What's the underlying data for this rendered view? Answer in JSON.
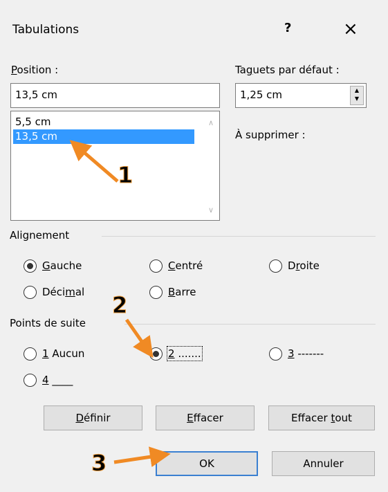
{
  "title": "Tabulations",
  "help_label": "?",
  "close_label": "×",
  "position": {
    "label_pre": "",
    "label_ul": "P",
    "label_post": "osition :",
    "value": "13,5 cm",
    "items": [
      "5,5 cm",
      "13,5 cm"
    ],
    "selected_index": 1
  },
  "default_tabs": {
    "label_pre": "Ta",
    "label_ul": "g",
    "label_post": "uets par défaut :",
    "value": "1,25 cm"
  },
  "to_delete_label": "À supprimer :",
  "alignment": {
    "heading": "Alignement",
    "options": [
      {
        "pre": "",
        "ul": "G",
        "post": "auche",
        "checked": true
      },
      {
        "pre": "",
        "ul": "C",
        "post": "entré",
        "checked": false
      },
      {
        "pre": "D",
        "ul": "r",
        "post": "oite",
        "checked": false
      },
      {
        "pre": "Déci",
        "ul": "m",
        "post": "al",
        "checked": false
      },
      {
        "pre": "",
        "ul": "B",
        "post": "arre",
        "checked": false
      }
    ]
  },
  "leader": {
    "heading": "Points de suite",
    "options": [
      {
        "pre": "",
        "ul": "1",
        "post": " Aucun",
        "checked": false
      },
      {
        "pre": "",
        "ul": "2",
        "post": " .......",
        "checked": true
      },
      {
        "pre": "",
        "ul": "3",
        "post": " -------",
        "checked": false
      },
      {
        "pre": "",
        "ul": "4",
        "post": " ____",
        "checked": false
      }
    ]
  },
  "buttons": {
    "define": {
      "pre": "",
      "ul": "D",
      "post": "éfinir"
    },
    "clear": {
      "pre": "",
      "ul": "E",
      "post": "ffacer"
    },
    "clear_all": {
      "pre": "Effacer ",
      "ul": "t",
      "post": "out"
    },
    "ok": "OK",
    "cancel": "Annuler"
  },
  "annotations": [
    "1",
    "2",
    "3"
  ],
  "colors": {
    "accent": "#3399ff",
    "arrow": "#f08a24",
    "default_button_border": "#3a7fd1"
  }
}
